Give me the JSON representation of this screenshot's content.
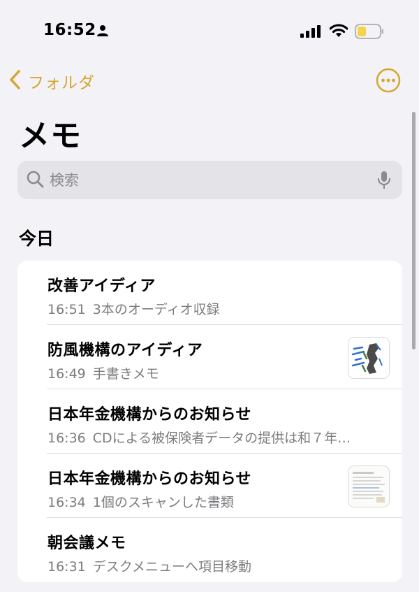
{
  "status_bar": {
    "time": "16:52"
  },
  "nav": {
    "back_label": "フォルダ"
  },
  "page": {
    "title": "メモ"
  },
  "search": {
    "placeholder": "検索"
  },
  "section": {
    "header": "今日"
  },
  "notes": [
    {
      "title": "改善アイディア",
      "time": "16:51",
      "preview": "3本のオーディオ収録"
    },
    {
      "title": "防風機構のアイディア",
      "time": "16:49",
      "preview": "手書きメモ"
    },
    {
      "title": "日本年金機構からのお知らせ",
      "time": "16:36",
      "preview": "CDによる被保険者データの提供は和７年…"
    },
    {
      "title": "日本年金機構からのお知らせ",
      "time": "16:34",
      "preview": "1個のスキャンした書類"
    },
    {
      "title": "朝会議メモ",
      "time": "16:31",
      "preview": "デスクメニューへ項目移動"
    }
  ],
  "colors": {
    "accent": "#d7a531",
    "background": "#f2f2f7",
    "secondary_text": "#7c7c80",
    "battery_fill": "#f4d44b"
  },
  "icons": {
    "status": [
      "person-icon",
      "signal-icon",
      "wifi-icon",
      "battery-icon"
    ],
    "nav": [
      "chevron-left-icon",
      "more-icon"
    ],
    "search": [
      "search-icon",
      "mic-icon"
    ]
  }
}
